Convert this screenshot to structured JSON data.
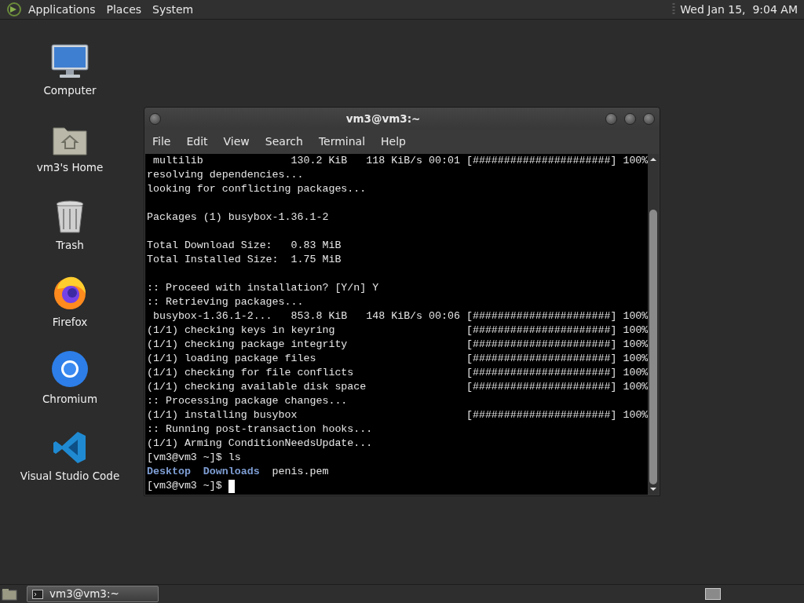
{
  "top_panel": {
    "menus": [
      "Applications",
      "Places",
      "System"
    ],
    "clock": "Wed Jan 15,  9:04 AM"
  },
  "desktop_icons": [
    {
      "kind": "computer",
      "label": "Computer"
    },
    {
      "kind": "home",
      "label": "vm3's Home"
    },
    {
      "kind": "trash",
      "label": "Trash"
    },
    {
      "kind": "firefox",
      "label": "Firefox"
    },
    {
      "kind": "chromium",
      "label": "Chromium"
    },
    {
      "kind": "vscode",
      "label": "Visual Studio Code"
    }
  ],
  "terminal": {
    "title": "vm3@vm3:~",
    "menu": [
      "File",
      "Edit",
      "View",
      "Search",
      "Terminal",
      "Help"
    ],
    "lines": [
      {
        "kind": "download",
        "label": "multilib",
        "size": "130.2 KiB",
        "rate": "118 KiB/s",
        "time": "00:01",
        "bar": "[######################]",
        "percent": "100%"
      },
      {
        "kind": "text",
        "text": "resolving dependencies..."
      },
      {
        "kind": "text",
        "text": "looking for conflicting packages..."
      },
      {
        "kind": "blank"
      },
      {
        "kind": "text",
        "text": "Packages (1) busybox-1.36.1-2"
      },
      {
        "kind": "blank"
      },
      {
        "kind": "text",
        "text": "Total Download Size:   0.83 MiB"
      },
      {
        "kind": "text",
        "text": "Total Installed Size:  1.75 MiB"
      },
      {
        "kind": "blank"
      },
      {
        "kind": "text",
        "text": ":: Proceed with installation? [Y/n] Y"
      },
      {
        "kind": "text",
        "text": ":: Retrieving packages..."
      },
      {
        "kind": "download",
        "label": "busybox-1.36.1-2...",
        "size": "853.8 KiB",
        "rate": "148 KiB/s",
        "time": "00:06",
        "bar": "[######################]",
        "percent": "100%"
      },
      {
        "kind": "step",
        "label": "(1/1) checking keys in keyring",
        "bar": "[######################]",
        "percent": "100%"
      },
      {
        "kind": "step",
        "label": "(1/1) checking package integrity",
        "bar": "[######################]",
        "percent": "100%"
      },
      {
        "kind": "step",
        "label": "(1/1) loading package files",
        "bar": "[######################]",
        "percent": "100%"
      },
      {
        "kind": "step",
        "label": "(1/1) checking for file conflicts",
        "bar": "[######################]",
        "percent": "100%"
      },
      {
        "kind": "step",
        "label": "(1/1) checking available disk space",
        "bar": "[######################]",
        "percent": "100%"
      },
      {
        "kind": "text",
        "text": ":: Processing package changes..."
      },
      {
        "kind": "step",
        "label": "(1/1) installing busybox",
        "bar": "[######################]",
        "percent": "100%"
      },
      {
        "kind": "text",
        "text": ":: Running post-transaction hooks..."
      },
      {
        "kind": "text",
        "text": "(1/1) Arming ConditionNeedsUpdate..."
      },
      {
        "kind": "text",
        "text": "[vm3@vm3 ~]$ ls"
      },
      {
        "kind": "listing",
        "items": [
          {
            "name": "Desktop",
            "kind": "directory"
          },
          {
            "name": "Downloads",
            "kind": "directory"
          },
          {
            "name": "penis.pem",
            "kind": "file"
          }
        ]
      },
      {
        "kind": "prompt",
        "text": "[vm3@vm3 ~]$",
        "cursor": true
      }
    ]
  },
  "taskbar": {
    "tasks": [
      {
        "label": "vm3@vm3:~",
        "selected": true
      }
    ]
  }
}
